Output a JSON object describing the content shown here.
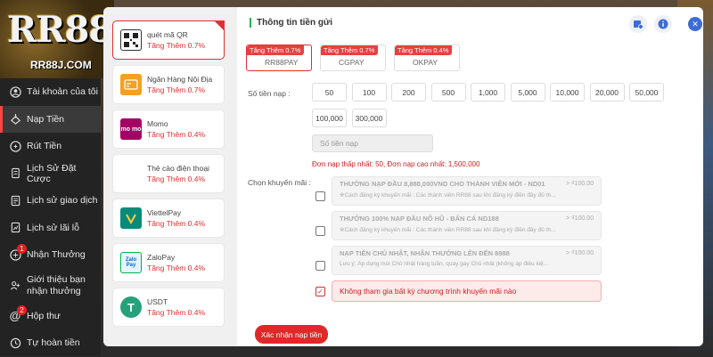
{
  "brand": {
    "logo": "RR88",
    "domain": "RR88J.COM"
  },
  "sidebar": {
    "items": [
      {
        "label": "Tài khoản của tôi",
        "icon": "user-icon"
      },
      {
        "label": "Nạp Tiền",
        "icon": "deposit-icon",
        "active": true
      },
      {
        "label": "Rút Tiền",
        "icon": "withdraw-icon"
      },
      {
        "label": "Lịch Sử Đặt Cược",
        "icon": "bet-history-icon"
      },
      {
        "label": "Lịch sử giao dịch",
        "icon": "transaction-history-icon"
      },
      {
        "label": "Lịch sử lãi lỗ",
        "icon": "profit-loss-icon"
      },
      {
        "label": "Nhận Thưởng",
        "icon": "gift-icon",
        "badge": "1"
      },
      {
        "label": "Giới thiệu bạn nhận thưởng",
        "icon": "referral-icon"
      },
      {
        "label": "Hộp thư",
        "icon": "mail-icon",
        "badge": "2"
      },
      {
        "label": "Tự hoàn tiền",
        "icon": "refund-icon"
      }
    ]
  },
  "methods": [
    {
      "name": "quét mã QR",
      "bonus": "Tăng Thêm 0.7%",
      "icon": "qr-icon"
    },
    {
      "name": "Ngân Hàng Nội Địa",
      "bonus": "Tăng Thêm 0.7%",
      "icon": "bank-icon"
    },
    {
      "name": "Momo",
      "bonus": "Tăng Thêm 0.4%",
      "icon": "momo-icon",
      "icon_text": "mo mo"
    },
    {
      "name": "Thẻ cào điện thoại",
      "bonus": "Tăng Thêm 0.4%",
      "icon": ""
    },
    {
      "name": "ViettelPay",
      "bonus": "Tăng Thêm 0.4%",
      "icon": "viettelpay-icon"
    },
    {
      "name": "ZaloPay",
      "bonus": "Tăng Thêm 0.4%",
      "icon": "zalopay-icon",
      "icon_text": "Zalo Pay"
    },
    {
      "name": "USDT",
      "bonus": "Tăng Thêm 0.4%",
      "icon": "usdt-icon",
      "icon_text": "T"
    }
  ],
  "form": {
    "title": "Thông tin tiền gửi",
    "gateways": [
      {
        "tag": "Tăng Thêm 0.7%",
        "name": "RR88PAY"
      },
      {
        "tag": "Tăng Thêm 0.7%",
        "name": "CGPAY"
      },
      {
        "tag": "Tăng Thêm 0.4%",
        "name": "OKPAY"
      }
    ],
    "amount_label": "Số tiền nạp :",
    "amounts": [
      "50",
      "100",
      "200",
      "500",
      "1,000",
      "5,000",
      "10,000",
      "20,000",
      "50,000",
      "100,000",
      "300,000"
    ],
    "amount_placeholder": "Số tiền nạp",
    "limits": "Đơn nạp thấp nhất:  50,  Đơn nạp cao nhất:  1,500,000",
    "promo_label": "Chọn khuyến mãi :",
    "promos": [
      {
        "title": "THƯỞNG NẠP ĐẦU 8,888,000VND CHO THÀNH VIÊN MỚI - ND01",
        "desc": "※Cách đăng ký khuyến mãi : Các thành viên RR88 sau khi đăng ký điền đầy đủ th...",
        "range": "> ₫100.00"
      },
      {
        "title": "THƯỞNG 100% NẠP ĐẦU NỔ HŨ - BẮN CÁ ND188",
        "desc": "※Cách đăng ký khuyến mãi : Các thành viên RR88 sau khi đăng ký điền đầy đủ th...",
        "range": "> ₫100.00"
      },
      {
        "title": "NẠP TIỀN CHỦ NHẬT, NHẬN THƯỞNG LÊN ĐẾN 8888",
        "desc": "Lưu ý: Áp dụng mỗi Chủ nhật hàng tuần, quay gay Chủ nhật (không áp điều kiệ...",
        "range": "> ₫100.00"
      }
    ],
    "no_promo": "Không tham gia bất kỳ chương trình khuyến mãi nào",
    "confirm": "Xác nhận nạp tiền"
  },
  "colors": {
    "accent": "#e02828",
    "close": "#3d6cd6",
    "sidebar": "#232323"
  }
}
